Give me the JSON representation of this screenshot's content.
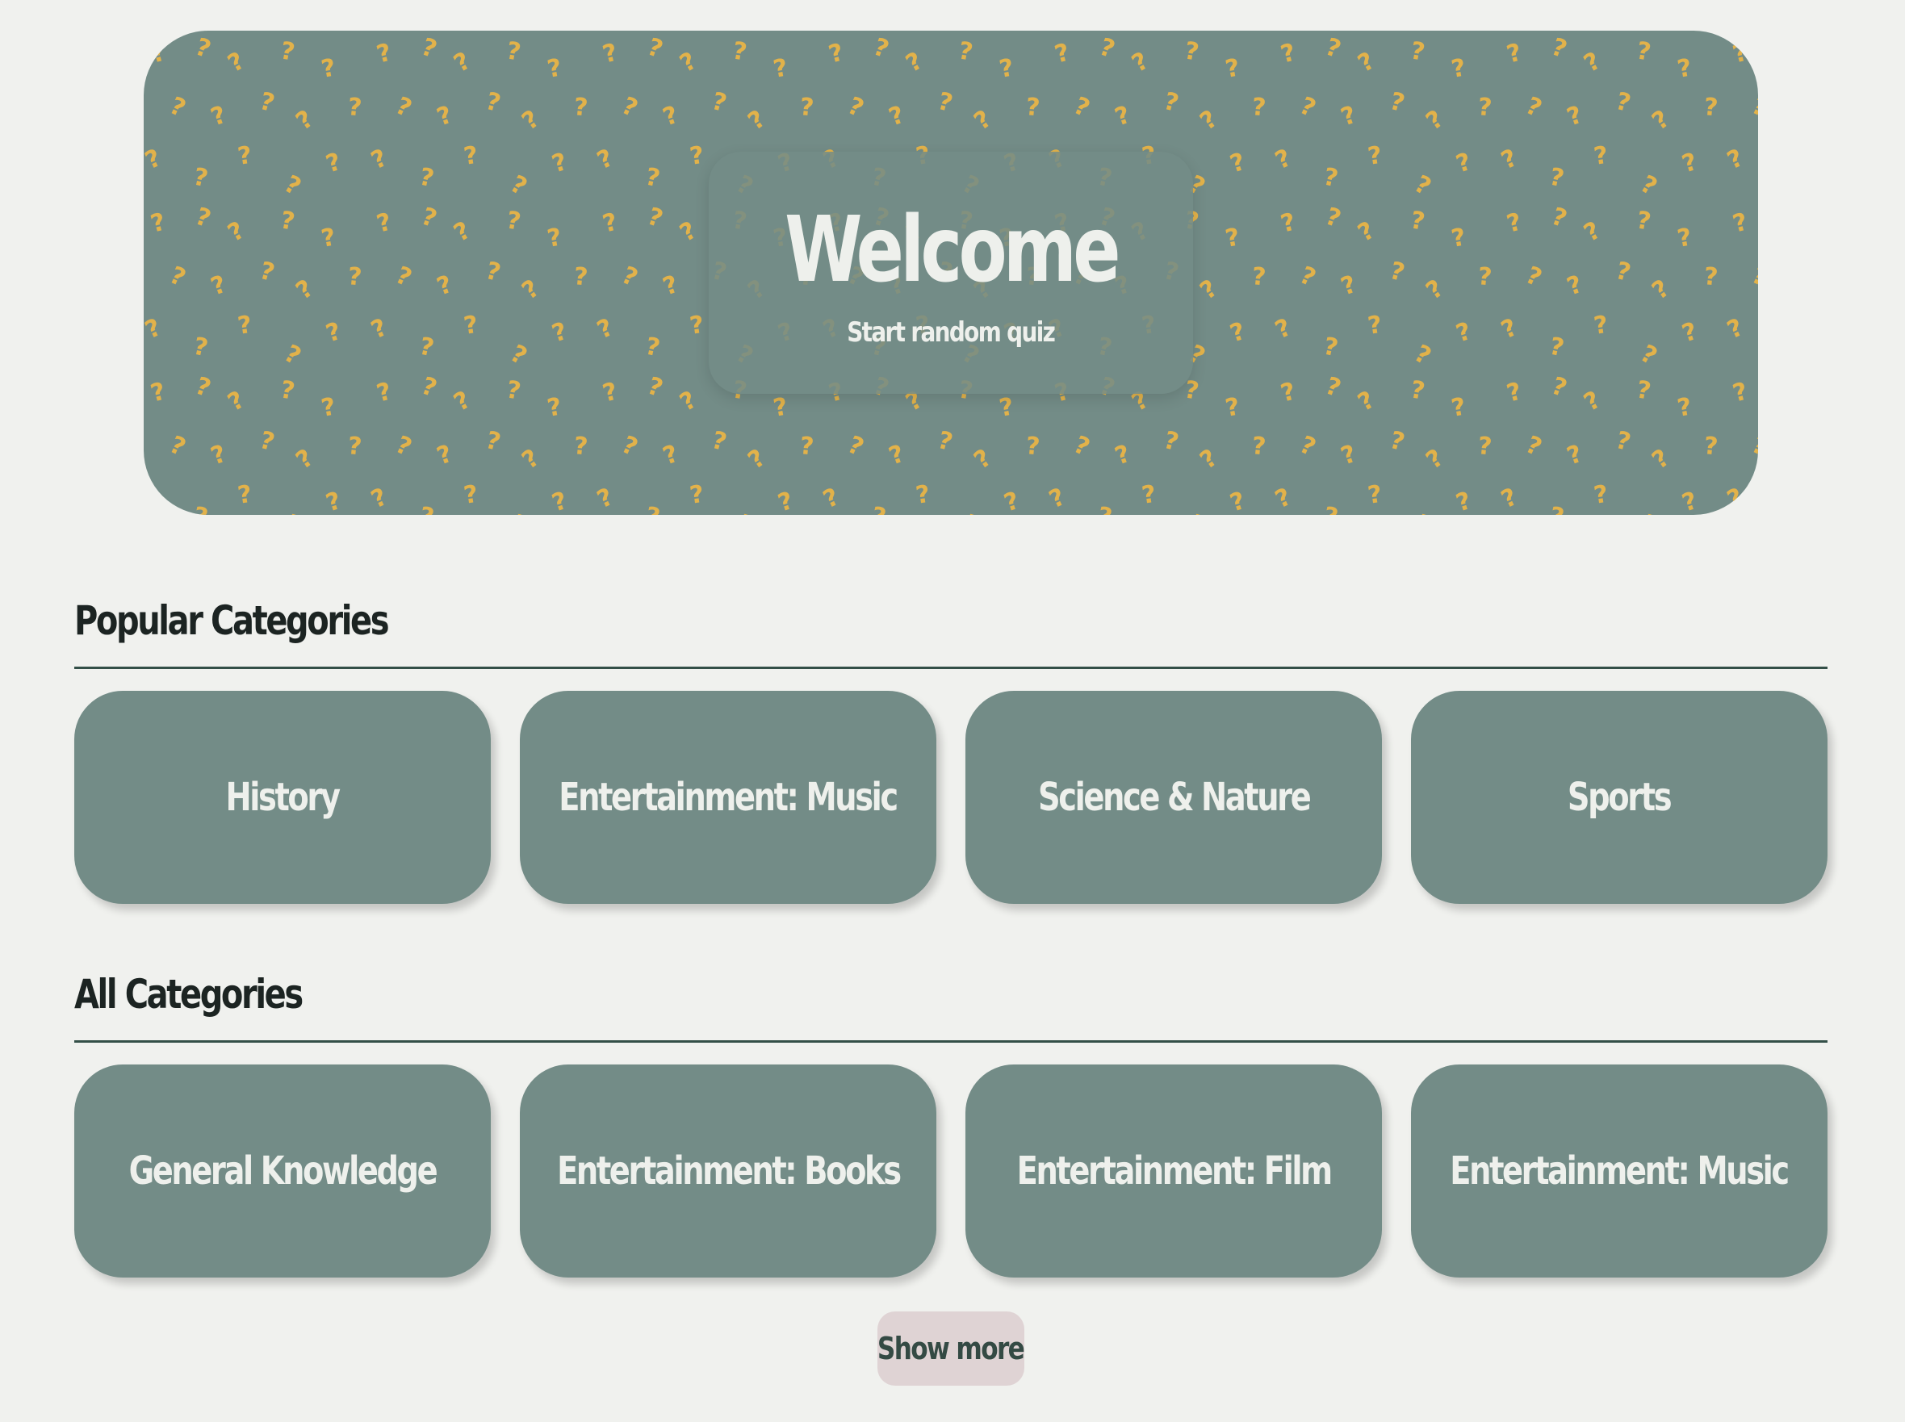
{
  "hero": {
    "title": "Welcome",
    "subtitle": "Start random quiz",
    "pattern_glyph": "?",
    "background_color": "#738c87",
    "pattern_color": "#e2b24a"
  },
  "popular": {
    "title": "Popular Categories",
    "items": [
      "History",
      "Entertainment: Music",
      "Science & Nature",
      "Sports"
    ]
  },
  "all": {
    "title": "All Categories",
    "items": [
      "General Knowledge",
      "Entertainment: Books",
      "Entertainment: Film",
      "Entertainment: Music"
    ]
  },
  "show_more_label": "Show more",
  "colors": {
    "page_background": "#f0f1ee",
    "card": "#738c87",
    "card_text": "#eef0ec",
    "divider": "#334f47",
    "show_more_bg": "#dfd3d4",
    "show_more_text": "#344a44"
  }
}
